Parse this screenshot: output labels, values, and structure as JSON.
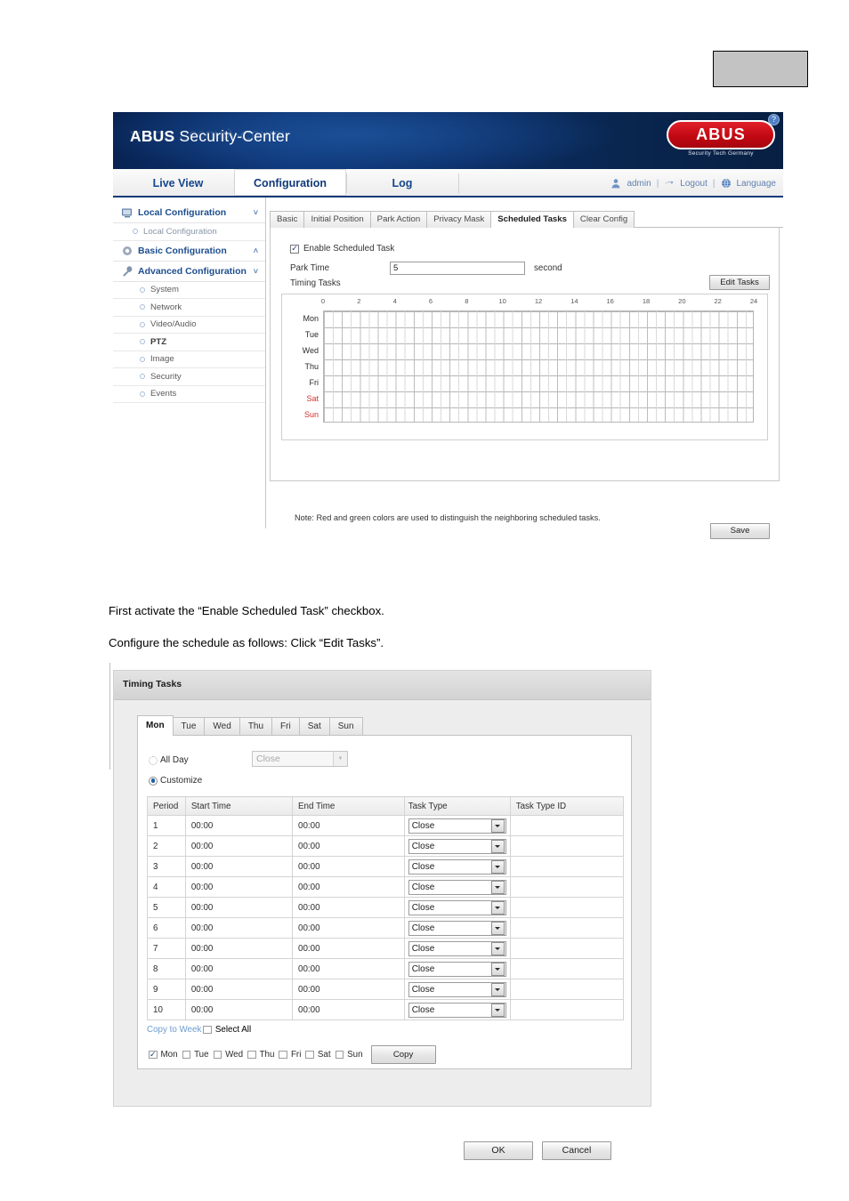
{
  "header": {
    "title_bold": "ABUS",
    "title_light": " Security-Center",
    "logo_text": "ABUS",
    "logo_tagline": "Security Tech Germany",
    "help_icon": "question-mark-icon",
    "brand_red": "#cf0a16",
    "banner_blue": "#0a2d6b"
  },
  "nav": {
    "tabs": [
      {
        "label": "Live View",
        "active": false
      },
      {
        "label": "Configuration",
        "active": true
      },
      {
        "label": "Log",
        "active": false
      }
    ],
    "user": "admin",
    "logout": "Logout",
    "language": "Language",
    "separator": "|"
  },
  "sidebar": {
    "groups": [
      {
        "label": "Local Configuration",
        "icon": "monitor-icon",
        "chevron": "˅"
      },
      {
        "label": "Basic Configuration",
        "icon": "gear-icon",
        "chevron": "˄"
      },
      {
        "label": "Advanced Configuration",
        "icon": "wrench-icon",
        "chevron": "˅"
      }
    ],
    "local_items": [
      "Local Configuration"
    ],
    "advanced_items": [
      {
        "label": "System",
        "bold": false
      },
      {
        "label": "Network",
        "bold": false
      },
      {
        "label": "Video/Audio",
        "bold": false
      },
      {
        "label": "PTZ",
        "bold": true
      },
      {
        "label": "Image",
        "bold": false
      },
      {
        "label": "Security",
        "bold": false
      },
      {
        "label": "Events",
        "bold": false
      }
    ]
  },
  "content": {
    "tabs": [
      {
        "label": "Basic",
        "active": false
      },
      {
        "label": "Initial Position",
        "active": false
      },
      {
        "label": "Park Action",
        "active": false
      },
      {
        "label": "Privacy Mask",
        "active": false
      },
      {
        "label": "Scheduled Tasks",
        "active": true
      },
      {
        "label": "Clear Config",
        "active": false
      }
    ],
    "enable_scheduled_task": {
      "label": "Enable Scheduled Task",
      "checked": true,
      "check_glyph": "✓"
    },
    "park_time": {
      "label": "Park Time",
      "value": "5",
      "unit": "second"
    },
    "timing_tasks_label": "Timing Tasks",
    "edit_tasks_button": "Edit Tasks",
    "note": "Note: Red and green colors are used to distinguish the neighboring scheduled tasks.",
    "save_button": "Save"
  },
  "chart_data": {
    "type": "heatmap",
    "title": "Timing Tasks",
    "xlabel": "",
    "ylabel": "",
    "hour_ticks": [
      0,
      2,
      4,
      6,
      8,
      10,
      12,
      14,
      16,
      18,
      20,
      22,
      24
    ],
    "categories": [
      "Mon",
      "Tue",
      "Wed",
      "Thu",
      "Fri",
      "Sat",
      "Sun"
    ],
    "weekend_categories": [
      "Sat",
      "Sun"
    ],
    "weekend_color": "#d4302a",
    "series": [
      {
        "name": "Mon",
        "values": []
      },
      {
        "name": "Tue",
        "values": []
      },
      {
        "name": "Wed",
        "values": []
      },
      {
        "name": "Thu",
        "values": []
      },
      {
        "name": "Fri",
        "values": []
      },
      {
        "name": "Sat",
        "values": []
      },
      {
        "name": "Sun",
        "values": []
      }
    ],
    "xlim": [
      0,
      24
    ],
    "grid": true,
    "legend": "none",
    "note": "Red and green colors are used to distinguish the neighboring scheduled tasks."
  },
  "instructions": {
    "line1": "First activate the “Enable Scheduled Task” checkbox.",
    "line2": "Configure the schedule as follows: Click “Edit Tasks”."
  },
  "dialog": {
    "title": "Timing Tasks",
    "day_tabs": [
      {
        "label": "Mon",
        "active": true
      },
      {
        "label": "Tue",
        "active": false
      },
      {
        "label": "Wed",
        "active": false
      },
      {
        "label": "Thu",
        "active": false
      },
      {
        "label": "Fri",
        "active": false
      },
      {
        "label": "Sat",
        "active": false
      },
      {
        "label": "Sun",
        "active": false
      }
    ],
    "all_day": {
      "label": "All Day",
      "selected": false
    },
    "all_day_select": {
      "value": "Close",
      "enabled": false
    },
    "customize": {
      "label": "Customize",
      "selected": true
    },
    "table": {
      "columns": [
        "Period",
        "Start Time",
        "End Time",
        "Task Type",
        "Task Type ID"
      ],
      "rows": [
        {
          "period": "1",
          "start": "00:00",
          "end": "00:00",
          "task_type": "Close",
          "task_type_id": ""
        },
        {
          "period": "2",
          "start": "00:00",
          "end": "00:00",
          "task_type": "Close",
          "task_type_id": ""
        },
        {
          "period": "3",
          "start": "00:00",
          "end": "00:00",
          "task_type": "Close",
          "task_type_id": ""
        },
        {
          "period": "4",
          "start": "00:00",
          "end": "00:00",
          "task_type": "Close",
          "task_type_id": ""
        },
        {
          "period": "5",
          "start": "00:00",
          "end": "00:00",
          "task_type": "Close",
          "task_type_id": ""
        },
        {
          "period": "6",
          "start": "00:00",
          "end": "00:00",
          "task_type": "Close",
          "task_type_id": ""
        },
        {
          "period": "7",
          "start": "00:00",
          "end": "00:00",
          "task_type": "Close",
          "task_type_id": ""
        },
        {
          "period": "8",
          "start": "00:00",
          "end": "00:00",
          "task_type": "Close",
          "task_type_id": ""
        },
        {
          "period": "9",
          "start": "00:00",
          "end": "00:00",
          "task_type": "Close",
          "task_type_id": ""
        },
        {
          "period": "10",
          "start": "00:00",
          "end": "00:00",
          "task_type": "Close",
          "task_type_id": ""
        }
      ]
    },
    "copy_to_week": {
      "link": "Copy to Week",
      "select_all": "Select All",
      "select_all_checked": false
    },
    "day_checks": [
      {
        "label": "Mon",
        "checked": true
      },
      {
        "label": "Tue",
        "checked": false
      },
      {
        "label": "Wed",
        "checked": false
      },
      {
        "label": "Thu",
        "checked": false
      },
      {
        "label": "Fri",
        "checked": false
      },
      {
        "label": "Sat",
        "checked": false
      },
      {
        "label": "Sun",
        "checked": false
      }
    ],
    "copy_button": "Copy",
    "ok_button": "OK",
    "cancel_button": "Cancel",
    "check_glyph": "✓"
  }
}
